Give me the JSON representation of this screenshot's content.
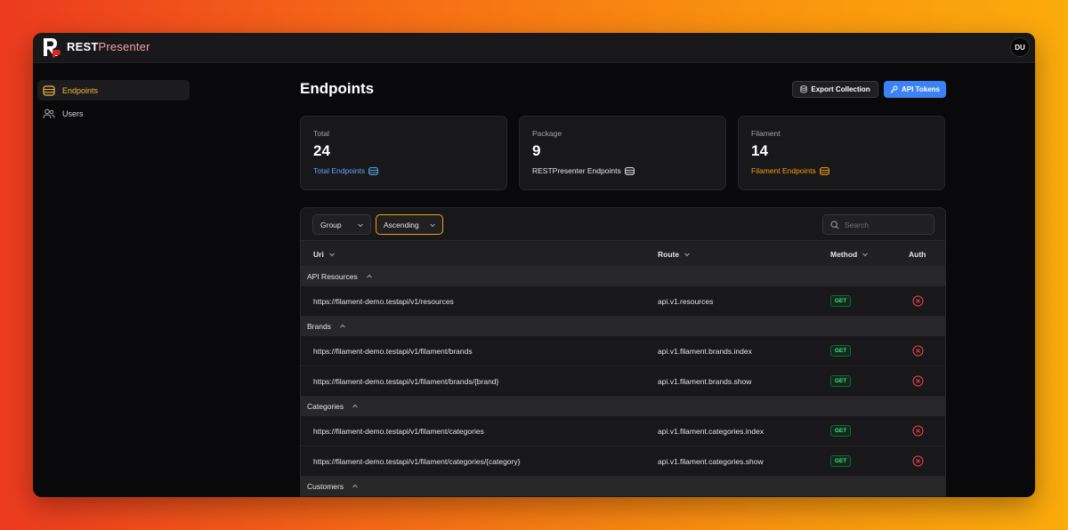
{
  "app": {
    "name_a": "REST",
    "name_b": "Presenter",
    "user_initials": "DU"
  },
  "sidebar": {
    "items": [
      {
        "label": "Endpoints",
        "icon": "database-icon"
      },
      {
        "label": "Users",
        "icon": "users-icon"
      }
    ]
  },
  "header": {
    "title": "Endpoints",
    "export_label": "Export Collection",
    "tokens_label": "API Tokens"
  },
  "stats": [
    {
      "label": "Total",
      "value": "24",
      "desc": "Total Endpoints",
      "color": "#60a5fa"
    },
    {
      "label": "Package",
      "value": "9",
      "desc": "RESTPresenter Endpoints",
      "color": "#e4e4e7"
    },
    {
      "label": "Filament",
      "value": "14",
      "desc": "Filament Endpoints",
      "color": "#f59e0b"
    }
  ],
  "filters": {
    "group": "Group",
    "order": "Ascending",
    "search_placeholder": "Search"
  },
  "table": {
    "columns": {
      "uri": "Uri",
      "route": "Route",
      "method": "Method",
      "auth": "Auth"
    },
    "groups": [
      {
        "label": "API Resources",
        "rows": [
          {
            "uri": "https://filament-demo.testapi/v1/resources",
            "route": "api.v1.resources",
            "method": "GET"
          }
        ]
      },
      {
        "label": "Brands",
        "rows": [
          {
            "uri": "https://filament-demo.testapi/v1/filament/brands",
            "route": "api.v1.filament.brands.index",
            "method": "GET"
          },
          {
            "uri": "https://filament-demo.testapi/v1/filament/brands/{brand}",
            "route": "api.v1.filament.brands.show",
            "method": "GET"
          }
        ]
      },
      {
        "label": "Categories",
        "rows": [
          {
            "uri": "https://filament-demo.testapi/v1/filament/categories",
            "route": "api.v1.filament.categories.index",
            "method": "GET"
          },
          {
            "uri": "https://filament-demo.testapi/v1/filament/categories/{category}",
            "route": "api.v1.filament.categories.show",
            "method": "GET"
          }
        ]
      },
      {
        "label": "Customers",
        "rows": []
      }
    ]
  },
  "colors": {
    "accent": "#f59e0b",
    "primary": "#3b82f6",
    "danger": "#ef4444",
    "success": "#4ade80"
  }
}
